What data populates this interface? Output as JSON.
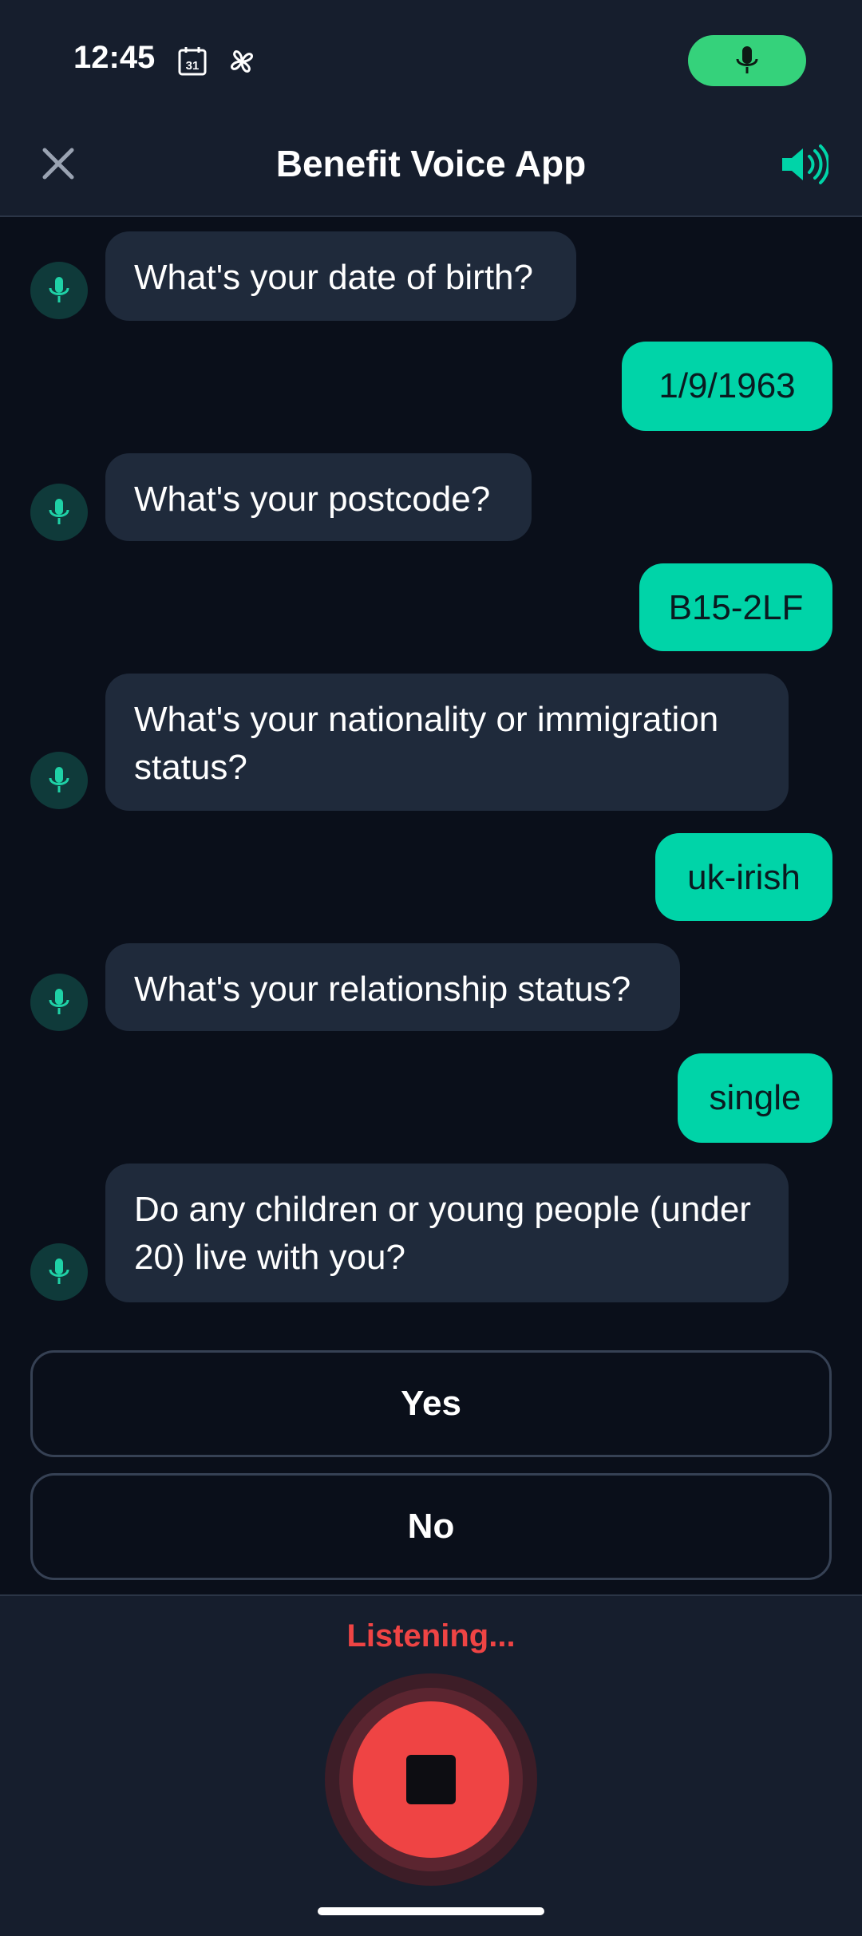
{
  "status_bar": {
    "time": "12:45",
    "calendar_day": "31",
    "mic_icon": "mic-icon"
  },
  "header": {
    "title": "Benefit Voice App",
    "close_icon": "close-icon",
    "speaker_icon": "speaker-icon"
  },
  "chat": {
    "messages": [
      {
        "role": "bot",
        "text": "What's your date of birth?"
      },
      {
        "role": "user",
        "text": "1/9/1963"
      },
      {
        "role": "bot",
        "text": "What's your postcode?"
      },
      {
        "role": "user",
        "text": "B15-2LF"
      },
      {
        "role": "bot",
        "text": "What's your nationality or immigration status?"
      },
      {
        "role": "user",
        "text": "uk-irish"
      },
      {
        "role": "bot",
        "text": "What's your relationship status?"
      },
      {
        "role": "user",
        "text": "single"
      },
      {
        "role": "bot",
        "text": "Do any children or young people (under 20) live with you?"
      }
    ]
  },
  "options": [
    {
      "label": "Yes"
    },
    {
      "label": "No"
    }
  ],
  "footer": {
    "status": "Listening...",
    "stop_icon": "stop-icon"
  },
  "colors": {
    "accent": "#00d4a8",
    "recording": "#ef4444",
    "mic_pill": "#35d27b",
    "background": "#0a0f1a"
  }
}
